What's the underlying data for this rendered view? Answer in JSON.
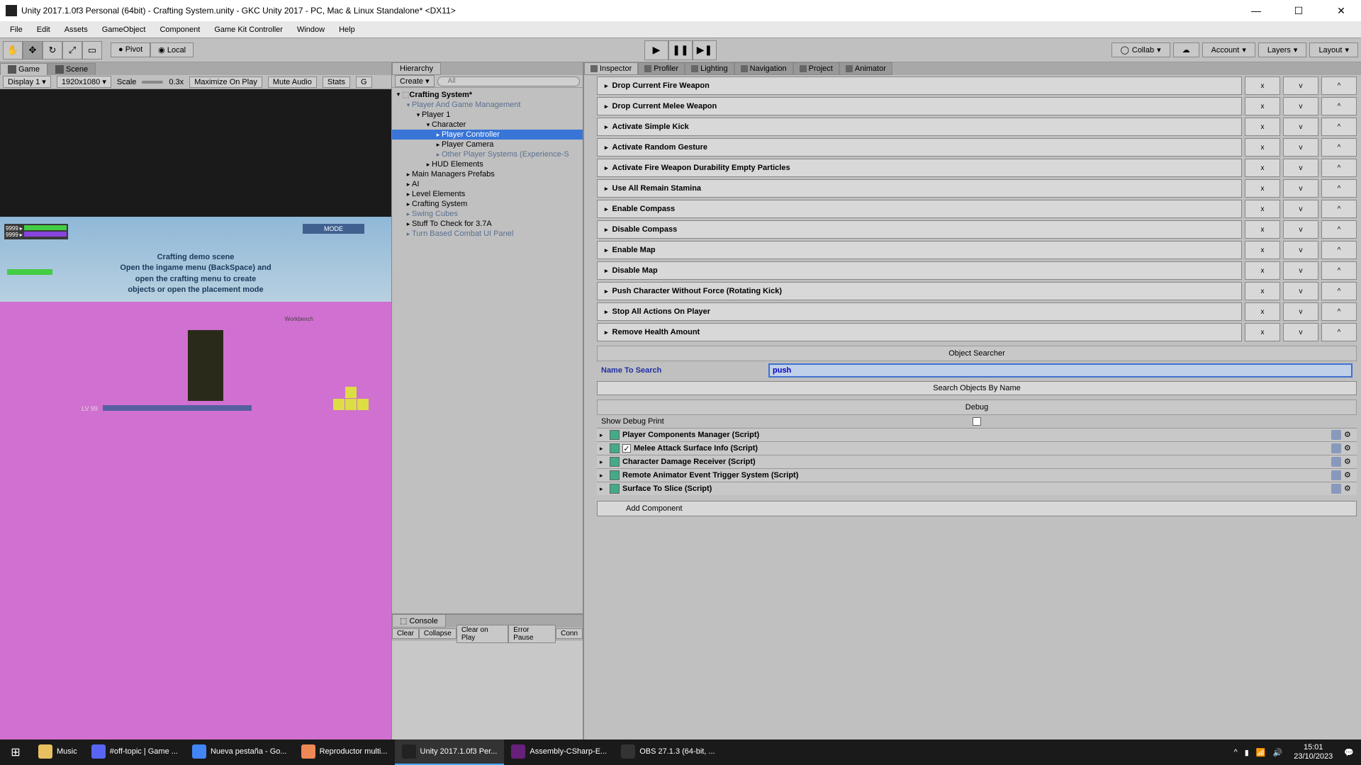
{
  "window": {
    "title": "Unity 2017.1.0f3 Personal (64bit) - Crafting System.unity - GKC Unity 2017 - PC, Mac & Linux Standalone* <DX11>"
  },
  "menubar": [
    "File",
    "Edit",
    "Assets",
    "GameObject",
    "Component",
    "Game Kit Controller",
    "Window",
    "Help"
  ],
  "toolbar": {
    "pivot": "Pivot",
    "local": "Local",
    "collab": "Collab",
    "account": "Account",
    "layers": "Layers",
    "layout": "Layout"
  },
  "left": {
    "tab_game": "Game",
    "tab_scene": "Scene",
    "display": "Display 1",
    "resolution": "1920x1080",
    "scale_label": "Scale",
    "scale_value": "0.3x",
    "maximize": "Maximize On Play",
    "mute": "Mute Audio",
    "stats": "Stats",
    "g": "G"
  },
  "game_view": {
    "hud_val": "9999",
    "mode": "MODE",
    "text1": "Crafting demo scene",
    "text2": "Open the ingame menu (BackSpace) and",
    "text3": "open the crafting menu to create",
    "text4": "objects or open the placement mode",
    "workbench": "Workbench",
    "lv": "LV 99"
  },
  "hierarchy": {
    "tab": "Hierarchy",
    "create": "Create",
    "search_placeholder": "All",
    "nodes": {
      "root": "Crafting System*",
      "n0": "Player And Game Management",
      "n1": "Player 1",
      "n2": "Character",
      "n3": "Player Controller",
      "n4": "Player Camera",
      "n5": "Other Player Systems (Experience-S",
      "n6": "HUD Elements",
      "n7": "Main Managers Prefabs",
      "n8": "AI",
      "n9": "Level Elements",
      "n10": "Crafting System",
      "n11": "Swing Cubes",
      "n12": "Stuff To Check for 3.7A",
      "n13": "Turn Based Combat UI Panel"
    }
  },
  "console": {
    "tab": "Console",
    "clear": "Clear",
    "collapse": "Collapse",
    "clear_on_play": "Clear on Play",
    "error_pause": "Error Pause",
    "conn": "Conn"
  },
  "inspector": {
    "tabs": {
      "inspector": "Inspector",
      "profiler": "Profiler",
      "lighting": "Lighting",
      "navigation": "Navigation",
      "project": "Project",
      "animator": "Animator"
    },
    "events": [
      "Drop Current Fire Weapon",
      "Drop Current Melee Weapon",
      "Activate Simple Kick",
      "Activate Random Gesture",
      "Activate Fire Weapon Durability Empty Particles",
      "Use All Remain Stamina",
      "Enable Compass",
      "Disable Compass",
      "Enable Map",
      "Disable Map",
      "Push Character Without Force (Rotating Kick)",
      "Stop All Actions On Player",
      "Remove Health Amount"
    ],
    "btn_x": "x",
    "btn_v": "v",
    "btn_up": "^",
    "searcher_title": "Object Searcher",
    "search_label": "Name To Search",
    "search_value": "push",
    "search_btn": "Search Objects By Name",
    "debug_title": "Debug",
    "debug_label": "Show Debug Print",
    "components": [
      "Player Components Manager (Script)",
      "Melee Attack Surface Info (Script)",
      "Character Damage Receiver (Script)",
      "Remote Animator Event Trigger System (Script)",
      "Surface To Slice (Script)"
    ],
    "add_component": "Add Component"
  },
  "taskbar": {
    "music": "Music",
    "items": [
      "#off-topic | Game ...",
      "Nueva pestaña - Go...",
      "Reproductor multi...",
      "Unity 2017.1.0f3 Per...",
      "Assembly-CSharp-E...",
      "OBS 27.1.3 (64-bit, ..."
    ],
    "time": "15:01",
    "date": "23/10/2023"
  }
}
